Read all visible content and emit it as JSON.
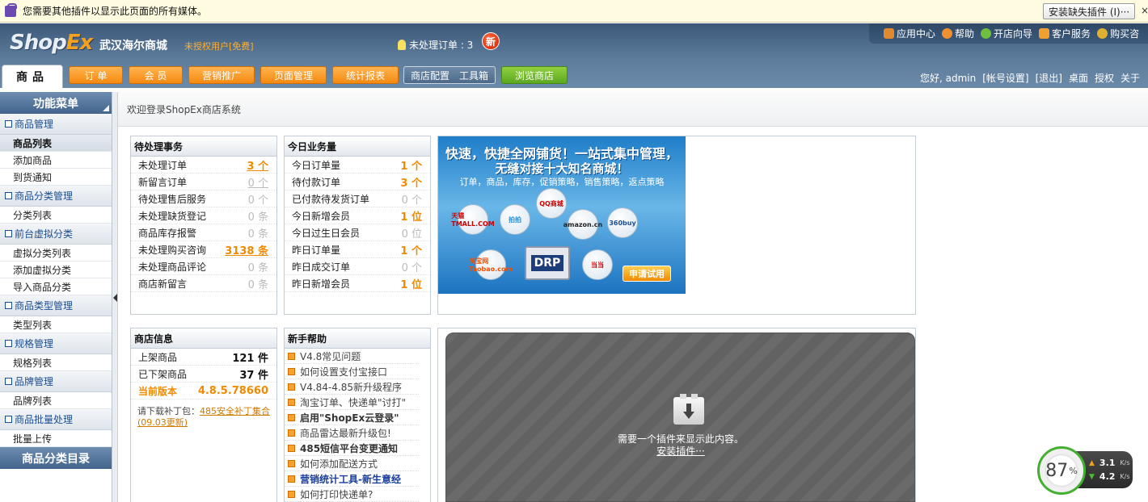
{
  "plugin_bar": {
    "message": "您需要其他插件以显示此页面的所有媒体。",
    "install_button": "安装缺失插件 (I)···",
    "close": "×"
  },
  "header": {
    "logo_shop": "Shop",
    "logo_ex": "Ex",
    "shop_name": "武汉海尔商城",
    "license": "未授权用户[免费]",
    "pending_orders": "未处理订单 : 3",
    "top_links": [
      "应用中心",
      "帮助",
      "开店向导",
      "客户服务",
      "购买咨"
    ],
    "user_links": [
      "您好, admin",
      "[帐号设置]",
      "[退出]",
      "桌面",
      "授权",
      "关于"
    ]
  },
  "nav": {
    "active_tab": "商品",
    "buttons": [
      "订 单",
      "会 员",
      "营销推广",
      "页面管理",
      "统计报表"
    ],
    "config": "商店配置",
    "toolbox": "工具箱",
    "new_badge": "新",
    "browse": "浏览商店"
  },
  "sidebar": {
    "title": "功能菜单",
    "groups": [
      {
        "label": "商品管理",
        "items": [
          "商品列表",
          "添加商品",
          "到货通知"
        ]
      },
      {
        "label": "商品分类管理",
        "items": [
          "分类列表"
        ]
      },
      {
        "label": "前台虚拟分类",
        "items": [
          "虚拟分类列表",
          "添加虚拟分类",
          "导入商品分类"
        ]
      },
      {
        "label": "商品类型管理",
        "items": [
          "类型列表"
        ]
      },
      {
        "label": "规格管理",
        "items": [
          "规格列表"
        ]
      },
      {
        "label": "品牌管理",
        "items": [
          "品牌列表"
        ]
      },
      {
        "label": "商品批量处理",
        "items": [
          "批量上传"
        ]
      }
    ],
    "footer": "商品分类目录"
  },
  "content": {
    "welcome": "欢迎登录ShopEx商店系统",
    "pending": {
      "title": "待处理事务",
      "rows": [
        {
          "label": "未处理订单",
          "value": "3 个"
        },
        {
          "label": "新留言订单",
          "value": "0 个"
        },
        {
          "label": "待处理售后服务",
          "value": "0 个"
        },
        {
          "label": "未处理缺货登记",
          "value": "0 条"
        },
        {
          "label": "商品库存报警",
          "value": "0 条"
        },
        {
          "label": "未处理购买咨询",
          "value": "3138 条"
        },
        {
          "label": "未处理商品评论",
          "value": "0 条"
        },
        {
          "label": "商店新留言",
          "value": "0 条"
        }
      ]
    },
    "today": {
      "title": "今日业务量",
      "rows": [
        {
          "label": "今日订单量",
          "value": "1 个"
        },
        {
          "label": "待付款订单",
          "value": "3 个"
        },
        {
          "label": "已付款待发货订单",
          "value": "0 个"
        },
        {
          "label": "今日新增会员",
          "value": "1 位"
        },
        {
          "label": "今日过生日会员",
          "value": "0 位"
        },
        {
          "label": "昨日订单量",
          "value": "1 个"
        },
        {
          "label": "昨日成交订单",
          "value": "0 个"
        },
        {
          "label": "昨日新增会员",
          "value": "1 位"
        }
      ]
    },
    "banner": {
      "line1": "快速，快捷全网铺货！一站式集中管理，",
      "line2": "无缝对接十大知名商城！",
      "line3": "订单，商品，库存，促销策略，销售策略，返点策略",
      "bubbles": [
        "天猫 TMALL.COM",
        "拍拍",
        "QQ商城",
        "amazon.cn",
        "360buy",
        "淘宝网 Taobao.com",
        "当当"
      ],
      "drp": "DRP",
      "trial": "申请试用"
    },
    "shop_info": {
      "title": "商店信息",
      "rows": [
        {
          "label": "上架商品",
          "value": "121 件"
        },
        {
          "label": "已下架商品",
          "value": "37 件"
        },
        {
          "label": "当前版本",
          "value": "4.8.5.78660"
        }
      ],
      "patch_prefix": "请下载补丁包：",
      "patch_link": "485安全补丁集合(09.03更新)"
    },
    "help": {
      "title": "新手帮助",
      "items": [
        "V4.8常见问题",
        "如何设置支付宝接口",
        "V4.84-4.85新升级程序",
        "淘宝订单、快递单\"讨打\"",
        "启用\"ShopEx云登录\"",
        "商品雷达最新升级包!",
        "485短信平台变更通知",
        "如何添加配送方式",
        "营销统计工具-新生意经",
        "如何打印快递单?"
      ]
    },
    "plugin_placeholder": {
      "text": "需要一个插件来显示此内容。",
      "link": "安装插件···"
    }
  },
  "speed": {
    "percent": "87",
    "unit": "%",
    "up": "3.1",
    "down": "4.2",
    "rate_unit": "K/s"
  }
}
